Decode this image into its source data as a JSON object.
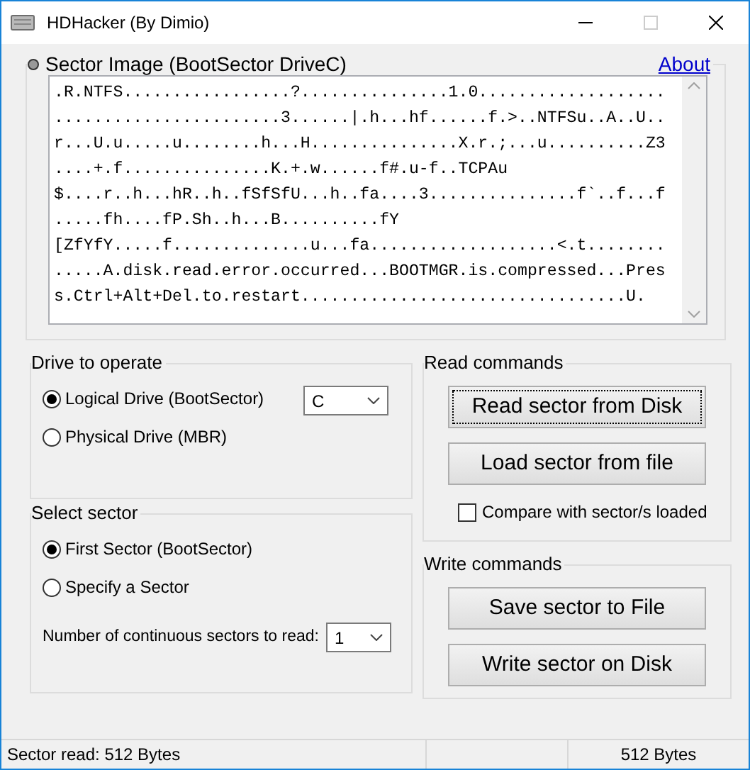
{
  "window": {
    "title": "HDHacker (By Dimio)"
  },
  "sector_image": {
    "title": "Sector Image (BootSector DriveC)",
    "about_link": "About",
    "lines": [
      ".R.NTFS.................?...............1.0...................",
      ".......................3......|.h...hf......f.>..NTFSu..A..U..",
      "r...U.u.....u........h...H...............X.r.;...u..........Z3",
      "....+.f...............K.+.w......f#.u-f..TCPAu",
      "$....r..h...hR..h..fSfSfU...h..fa....3...............f`..f...f",
      ".....fh....fP.Sh..h...B..........fY",
      "[ZfYfY.....f..............u...fa...................<.t........",
      ".....A.disk.read.error.occurred...BOOTMGR.is.compressed...Pres",
      "s.Ctrl+Alt+Del.to.restart.................................U."
    ]
  },
  "drive_to_operate": {
    "title": "Drive to operate",
    "options": [
      {
        "label": "Logical Drive (BootSector)",
        "selected": true
      },
      {
        "label": "Physical Drive (MBR)",
        "selected": false
      }
    ],
    "drive_select": "C"
  },
  "select_sector": {
    "title": "Select sector",
    "options": [
      {
        "label": "First Sector (BootSector)",
        "selected": true
      },
      {
        "label": "Specify a Sector",
        "selected": false
      }
    ],
    "count_label": "Number of continuous sectors to read:",
    "count_select": "1"
  },
  "read_commands": {
    "title": "Read commands",
    "buttons": [
      {
        "label": "Read sector from Disk",
        "focused": true
      },
      {
        "label": "Load sector from file",
        "focused": false
      }
    ],
    "compare": {
      "label": "Compare with sector/s loaded",
      "checked": false
    }
  },
  "write_commands": {
    "title": "Write commands",
    "buttons": [
      {
        "label": "Save sector to File",
        "focused": false
      },
      {
        "label": "Write sector on Disk",
        "focused": false
      }
    ]
  },
  "status_bar": {
    "left": "Sector read: 512 Bytes",
    "right": "512 Bytes"
  }
}
